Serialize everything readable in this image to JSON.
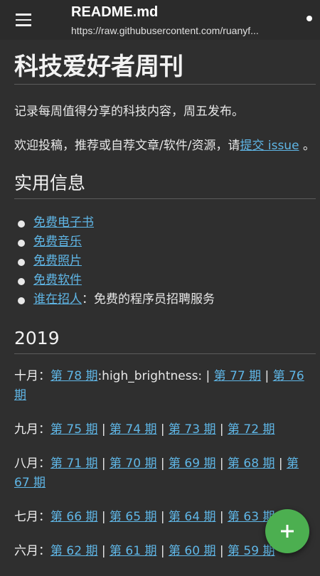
{
  "appbar": {
    "title": "README.md",
    "url": "https://raw.githubusercontent.com/ruanyf..."
  },
  "doc": {
    "h1": "科技爱好者周刊",
    "intro": "记录每周值得分享的科技内容，周五发布。",
    "contrib_text": "欢迎投稿，推荐或自荐文章/软件/资源，请",
    "contrib_link": "提交 issue",
    "contrib_end": "。",
    "section_info": "实用信息",
    "info_items": [
      {
        "link": "免费电子书",
        "text": ""
      },
      {
        "link": "免费音乐",
        "text": ""
      },
      {
        "link": "免费照片",
        "text": ""
      },
      {
        "link": "免费软件",
        "text": ""
      },
      {
        "link": "谁在招人",
        "text": "：免费的程序员招聘服务"
      }
    ],
    "section_year": "2019",
    "months": [
      {
        "month": "十月：",
        "issues": [
          "第 78 期",
          "第 77 期",
          "第 76 期"
        ],
        "note_after_first": ":high_brightness:"
      },
      {
        "month": "九月：",
        "issues": [
          "第 75 期",
          "第 74 期",
          "第 73 期",
          "第 72 期"
        ]
      },
      {
        "month": "八月：",
        "issues": [
          "第 71 期",
          "第 70 期",
          "第 69 期",
          "第 68 期",
          "第 67 期"
        ]
      },
      {
        "month": "七月：",
        "issues": [
          "第 66 期",
          "第 65 期",
          "第 64 期",
          "第 63 期"
        ]
      },
      {
        "month": "六月：",
        "issues": [
          "第 62 期",
          "第 61 期",
          "第 60 期",
          "第 59 期"
        ]
      }
    ],
    "separator": " | "
  },
  "fab": {
    "icon": "plus-icon",
    "color": "#4caf50"
  },
  "colors": {
    "link": "#5fb6e6",
    "background": "#2f2f2f",
    "appbar": "#2b2b2b"
  }
}
